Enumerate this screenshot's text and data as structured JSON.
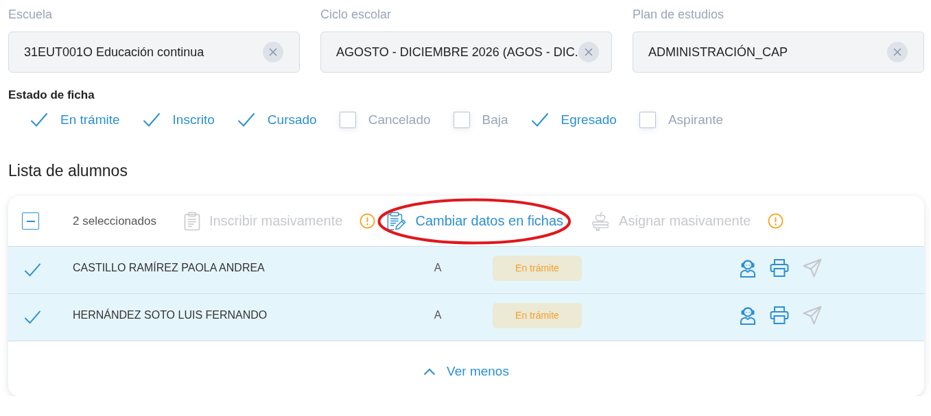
{
  "filters_bar": {
    "fields": [
      {
        "label": "Escuela",
        "value": "31EUT001O Educación continua"
      },
      {
        "label": "Ciclo escolar",
        "value": "AGOSTO - DICIEMBRE 2026 (AGOS - DIC."
      },
      {
        "label": "Plan de estudios",
        "value": "ADMINISTRACIÓN_CAP"
      }
    ]
  },
  "status_filter": {
    "title": "Estado de ficha",
    "options": [
      {
        "label": "En trámite",
        "checked": true
      },
      {
        "label": "Inscrito",
        "checked": true
      },
      {
        "label": "Cursado",
        "checked": true
      },
      {
        "label": "Cancelado",
        "checked": false
      },
      {
        "label": "Baja",
        "checked": false
      },
      {
        "label": "Egresado",
        "checked": true
      },
      {
        "label": "Aspirante",
        "checked": false
      }
    ]
  },
  "student_list": {
    "title": "Lista de alumnos",
    "select_all": {
      "indeterminate": true
    },
    "selection_count": "2 seleccionados",
    "actions": [
      {
        "kind": "enroll",
        "label": "Inscribir masivamente",
        "disabled": true,
        "warning": true,
        "highlighted": false
      },
      {
        "kind": "edit",
        "label": "Cambiar datos en fichas",
        "disabled": false,
        "warning": false,
        "highlighted": true
      },
      {
        "kind": "assign",
        "label": "Asignar masivamente",
        "disabled": true,
        "warning": true,
        "highlighted": false
      }
    ],
    "rows": [
      {
        "selected": true,
        "name": "CASTILLO RAMÍREZ PAOLA ANDREA",
        "group": "A",
        "status": "En trámite",
        "row_actions": [
          {
            "kind": "profile",
            "disabled": false
          },
          {
            "kind": "print",
            "disabled": false
          },
          {
            "kind": "send",
            "disabled": true
          }
        ]
      },
      {
        "selected": true,
        "name": "HERNÁNDEZ SOTO LUIS FERNANDO",
        "group": "A",
        "status": "En trámite",
        "row_actions": [
          {
            "kind": "profile",
            "disabled": false
          },
          {
            "kind": "print",
            "disabled": false
          },
          {
            "kind": "send",
            "disabled": true
          }
        ]
      }
    ],
    "toggle": "Ver menos"
  }
}
